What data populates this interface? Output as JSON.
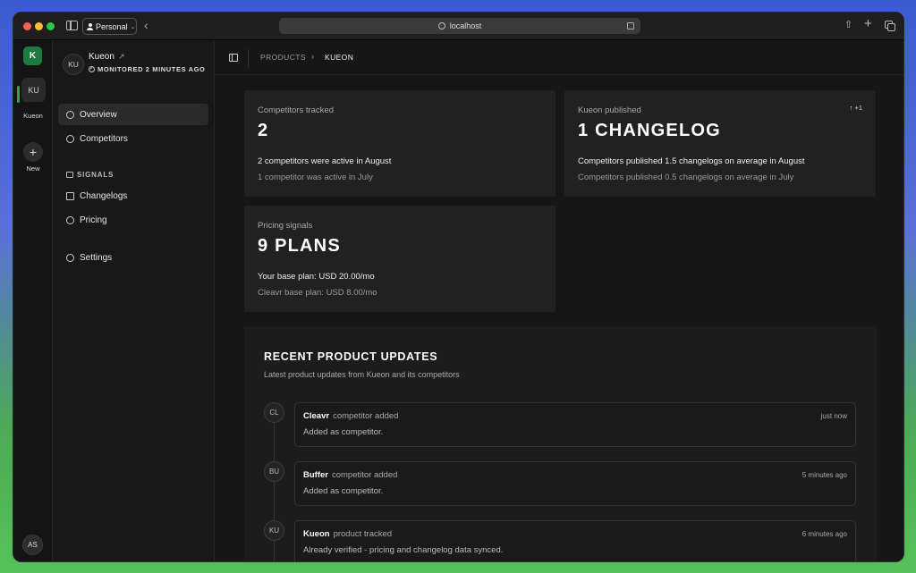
{
  "browser": {
    "profile": "Personal",
    "url": "localhost"
  },
  "rail": {
    "workspace_initial": "K",
    "project_initials": "KU",
    "project_label": "Kueon",
    "new_label": "New",
    "user_initials": "AS"
  },
  "sidebar": {
    "avatar": "KU",
    "product_name": "Kueon",
    "status": "MONITORED 2 MINUTES AGO",
    "nav": [
      {
        "label": "Overview",
        "icon": "overview-icon"
      },
      {
        "label": "Competitors",
        "icon": "users-icon"
      }
    ],
    "signals_title": "SIGNALS",
    "signals": [
      {
        "label": "Changelogs",
        "icon": "document-icon"
      },
      {
        "label": "Pricing",
        "icon": "dollar-icon"
      }
    ],
    "settings": "Settings"
  },
  "breadcrumb": {
    "parent": "PRODUCTS",
    "separator": "›",
    "current": "KUEON"
  },
  "cards": {
    "competitors": {
      "label": "Competitors tracked",
      "value": "2",
      "line1": "2 competitors were active in August",
      "line2": "1 competitor was active in July"
    },
    "published": {
      "label": "Kueon published",
      "badge": "↑ +1",
      "value": "1 CHANGELOG",
      "line1": "Competitors published 1.5 changelogs on average in August",
      "line2": "Competitors published 0.5 changelogs on average in July"
    },
    "pricing": {
      "label": "Pricing signals",
      "value": "9 PLANS",
      "line1": "Your base plan: USD 20.00/mo",
      "line2": "Cleavr base plan: USD 8.00/mo"
    }
  },
  "updates": {
    "title": "RECENT PRODUCT UPDATES",
    "subtitle": "Latest product updates from Kueon and its competitors",
    "items": [
      {
        "initials": "CL",
        "name": "Cleavr",
        "action": "competitor added",
        "time": "just now",
        "body": "Added as competitor."
      },
      {
        "initials": "BU",
        "name": "Buffer",
        "action": "competitor added",
        "time": "5 minutes ago",
        "body": "Added as competitor."
      },
      {
        "initials": "KU",
        "name": "Kueon",
        "action": "product tracked",
        "time": "6 minutes ago",
        "body": "Already verified - pricing and changelog data synced."
      }
    ]
  },
  "colors": {
    "accent": "#1e7a3d",
    "background": "#161616",
    "card": "#212121"
  }
}
